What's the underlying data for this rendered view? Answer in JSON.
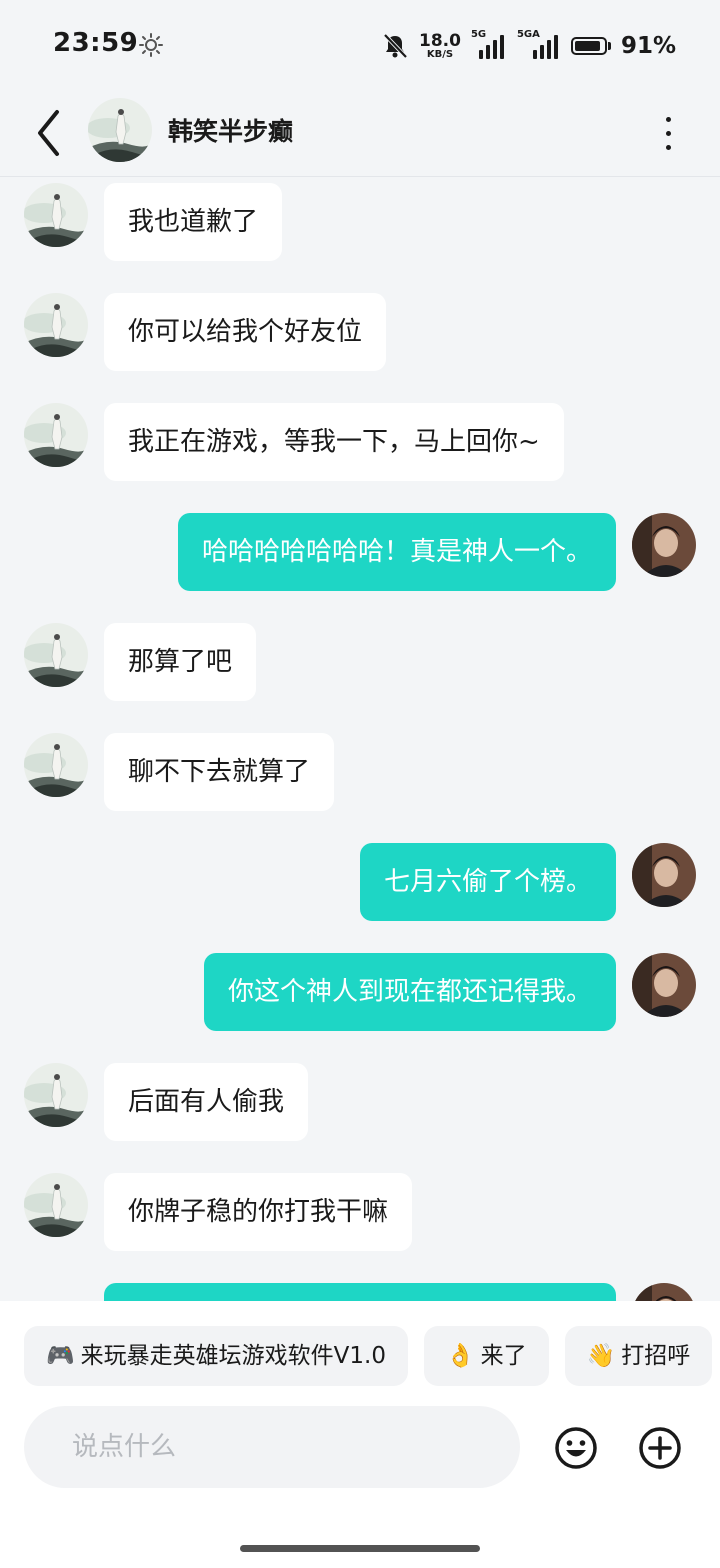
{
  "status": {
    "time": "23:59",
    "net_speed": "18.0",
    "net_unit": "KB/S",
    "sig1_label": "5G",
    "sig2_label": "5GA",
    "battery_pct": "91%",
    "battery_level": 0.91
  },
  "header": {
    "title": "韩笑半步癫"
  },
  "messages": [
    {
      "dir": "in",
      "text": "我也道歉了"
    },
    {
      "dir": "in",
      "text": "你可以给我个好友位"
    },
    {
      "dir": "in",
      "text": "我正在游戏，等我一下，马上回你~"
    },
    {
      "dir": "out",
      "text": "哈哈哈哈哈哈哈！真是神人一个。"
    },
    {
      "dir": "in",
      "text": "那算了吧"
    },
    {
      "dir": "in",
      "text": "聊不下去就算了"
    },
    {
      "dir": "out",
      "text": "七月六偷了个榜。"
    },
    {
      "dir": "out",
      "text": "你这个神人到现在都还记得我。"
    },
    {
      "dir": "in",
      "text": "后面有人偷我"
    },
    {
      "dir": "in",
      "text": "你牌子稳的你打我干嘛"
    },
    {
      "dir": "out",
      "text": ""
    }
  ],
  "quick_replies": [
    {
      "icon": "game-controller-icon",
      "glyph": "🎮",
      "label": "来玩暴走英雄坛游戏软件V1.0"
    },
    {
      "icon": "ok-hand-icon",
      "glyph": "👌",
      "label": "来了"
    },
    {
      "icon": "waving-hand-icon",
      "glyph": "👋",
      "label": "打招呼"
    }
  ],
  "input": {
    "placeholder": "说点什么"
  },
  "colors": {
    "accent": "#1ed6c5",
    "background": "#f3f5f7"
  }
}
